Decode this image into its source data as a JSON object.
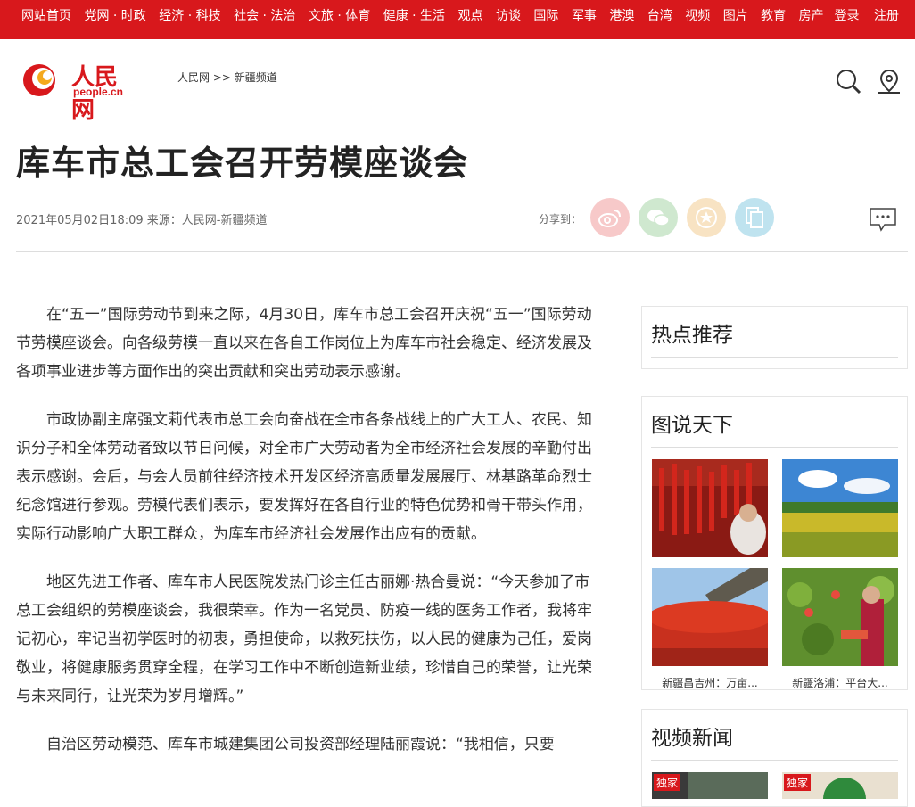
{
  "topnav": {
    "items": [
      "网站首页",
      "党网 · 时政",
      "经济 · 科技",
      "社会 · 法治",
      "文旅 · 体育",
      "健康 · 生活",
      "观点",
      "访谈",
      "国际",
      "军事",
      "港澳",
      "台湾",
      "视频",
      "图片",
      "教育",
      "房产"
    ],
    "login": "登录",
    "register": "注册"
  },
  "logo": {
    "name": "人民网",
    "sub": "people.cn"
  },
  "breadcrumb": "人民网 >> 新疆频道",
  "article": {
    "title": "库车市总工会召开劳模座谈会",
    "meta": "2021年05月02日18:09  来源：人民网-新疆频道",
    "share_label": "分享到：",
    "paragraphs": [
      "在“五一”国际劳动节到来之际，4月30日，库车市总工会召开庆祝“五一”国际劳动节劳模座谈会。向各级劳模一直以来在各自工作岗位上为库车市社会稳定、经济发展及各项事业进步等方面作出的突出贡献和突出劳动表示感谢。",
      "市政协副主席强文莉代表市总工会向奋战在全市各条战线上的广大工人、农民、知识分子和全体劳动者致以节日问候，对全市广大劳动者为全市经济社会发展的辛勤付出表示感谢。会后，与会人员前往经济技术开发区经济高质量发展展厅、林基路革命烈士纪念馆进行参观。劳模代表们表示，要发挥好在各自行业的特色优势和骨干带头作用，实际行动影响广大职工群众，为库车市经济社会发展作出应有的贡献。",
      "地区先进工作者、库车市人民医院发热门诊主任古丽娜·热合曼说：“今天参加了市总工会组织的劳模座谈会，我很荣幸。作为一名党员、防疫一线的医务工作者，我将牢记初心，牢记当初学医时的初衷，勇担使命，以救死扶伤，以人民的健康为己任，爱岗敬业，将健康服务贯穿全程，在学习工作中不断创造新业绩，珍惜自己的荣誉，让光荣与未来同行，让光荣为岁月增辉。”",
      "自治区劳动模范、库车市城建集团公司投资部经理陆丽霞说：“我相信，只要"
    ]
  },
  "sidebar": {
    "hot_title": "热点推荐",
    "photo_title": "图说天下",
    "captions": [
      "新疆昌吉州：万亩...",
      "新疆洛浦：平台大..."
    ],
    "video_title": "视频新闻",
    "badge": "独家"
  },
  "colors": {
    "brand_red": "#d8181c"
  }
}
